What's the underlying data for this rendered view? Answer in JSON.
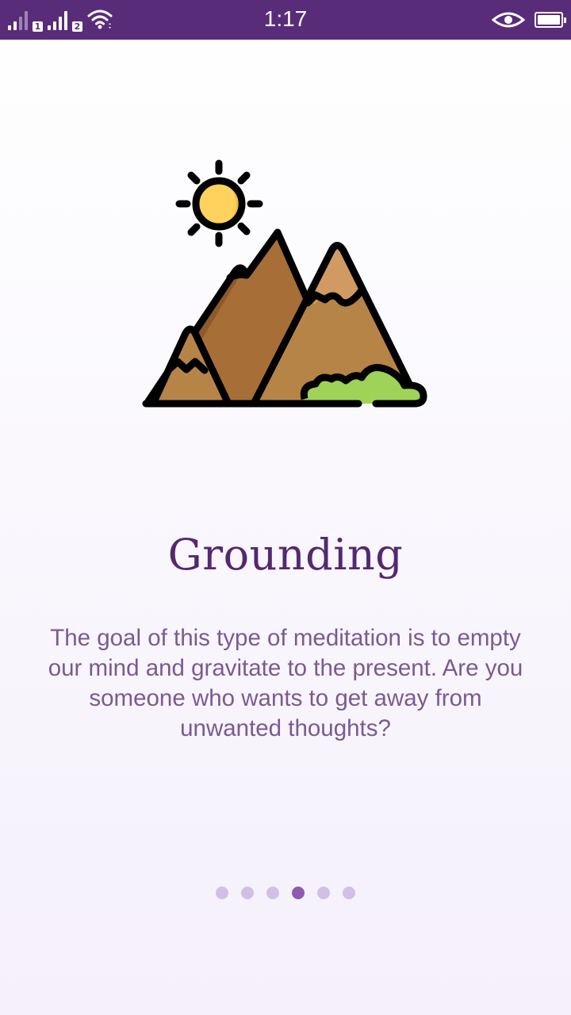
{
  "status_bar": {
    "time": "1:17",
    "sim1_label": "1",
    "sim2_label": "2",
    "icons": [
      "signal-sim1-icon",
      "signal-sim2-icon",
      "wifi-icon",
      "eye-icon",
      "battery-icon"
    ],
    "background_color": "#592c79"
  },
  "illustration": {
    "icon": "mountains-with-sun-icon"
  },
  "slide": {
    "title": "Grounding",
    "description": "The goal of this type of meditation is to empty our mind and gravitate to the present. Are you someone who wants to get away from unwanted thoughts?"
  },
  "pager": {
    "total": 6,
    "active_index": 3,
    "active_color": "#8e5bb3",
    "inactive_color": "#d2bfe5"
  },
  "colors": {
    "title": "#54296f",
    "body_text": "#7a5a92"
  }
}
